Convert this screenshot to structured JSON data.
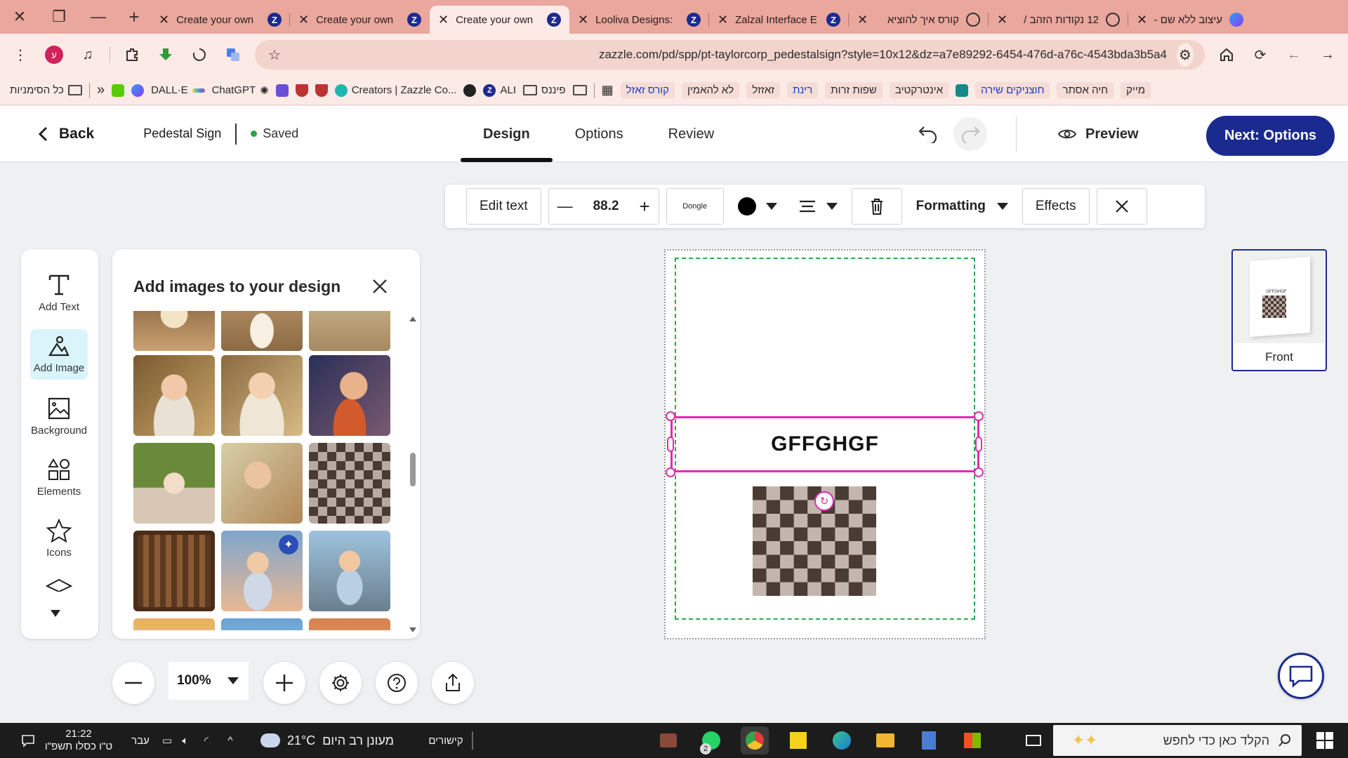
{
  "browser": {
    "tabs": [
      {
        "title": "Create your own",
        "favicon": "zazzle-icon"
      },
      {
        "title": "Create your own",
        "favicon": "zazzle-icon"
      },
      {
        "title": "Create your own",
        "favicon": "zazzle-icon",
        "active": true
      },
      {
        "title": "Looliva Designs:",
        "favicon": "zazzle-icon"
      },
      {
        "title": "Zalzal Interface E",
        "favicon": "zazzle-icon"
      },
      {
        "title": "קורס איך להוציא",
        "favicon": "loading-icon"
      },
      {
        "title": "12 נקודות הזהב /",
        "favicon": "loading-icon"
      },
      {
        "title": "עיצוב ללא שם -",
        "favicon": "canva-icon"
      }
    ],
    "url": "zazzle.com/pd/spp/pt-taylorcorp_pedestalsign?style=10x12&dz=a7e89292-6454-476d-a76c-4543bda3b5a4",
    "profile_initial": "ע",
    "bookmarks": [
      {
        "label": "כל הסימניות",
        "icon": "folder-icon"
      },
      {
        "label": "",
        "icon": "duolingo-icon"
      },
      {
        "label": "",
        "icon": "canva-icon"
      },
      {
        "label": "DALL·E",
        "icon": "dalle-icon"
      },
      {
        "label": "ChatGPT",
        "icon": "chatgpt-icon"
      },
      {
        "label": "",
        "icon": "app-icon"
      },
      {
        "label": "",
        "icon": "shield-icon"
      },
      {
        "label": "",
        "icon": "shield-icon"
      },
      {
        "label": "Creators | Zazzle Co...",
        "icon": "creators-icon"
      },
      {
        "label": "",
        "icon": "globe-icon"
      },
      {
        "label": "ALI",
        "icon": "zazzle-icon"
      },
      {
        "label": "פיננס",
        "icon": "folder-icon"
      },
      {
        "label": "",
        "icon": "folder-icon"
      },
      {
        "label": "קורס זאזל",
        "icon": "apps-grid-icon"
      },
      {
        "label": "לא להאמין"
      },
      {
        "label": "זאזזל"
      },
      {
        "label": "רינת"
      },
      {
        "label": "שפות זרות"
      },
      {
        "label": "אינטרקטיב"
      },
      {
        "label": "חוצניקים שירה",
        "icon": "teal-square-icon"
      },
      {
        "label": "חיה אסתר"
      },
      {
        "label": "מייק"
      }
    ]
  },
  "app": {
    "back_label": "Back",
    "product_name": "Pedestal Sign",
    "saved_label": "Saved",
    "nav_tabs": [
      "Design",
      "Options",
      "Review"
    ],
    "active_tab": "Design",
    "preview_label": "Preview",
    "next_label": "Next: Options"
  },
  "text_toolbar": {
    "edit_text": "Edit text",
    "font_size": "88.2",
    "font_name": "Dongle",
    "text_color": "#000000",
    "formatting": "Formatting",
    "effects": "Effects"
  },
  "rail": {
    "items": [
      {
        "label": "Add Text",
        "icon": "text-icon"
      },
      {
        "label": "Add Image",
        "icon": "image-icon",
        "active": true
      },
      {
        "label": "Background",
        "icon": "background-icon"
      },
      {
        "label": "Elements",
        "icon": "elements-icon"
      },
      {
        "label": "Icons",
        "icon": "star-icon"
      }
    ]
  },
  "image_panel": {
    "title": "Add images to your design"
  },
  "zoom": {
    "value": "100%"
  },
  "canvas": {
    "text_content": "GFFGHGF"
  },
  "views": {
    "front_label": "Front"
  },
  "taskbar": {
    "time": "21:22",
    "date": "ט\"ו כסלו תשפ\"ו",
    "language": "עבר",
    "weather_temp": "21°C",
    "weather_text": "מעונן רב היום",
    "links_label": "קישורים",
    "search_placeholder": "הקלד כאן כדי לחפש",
    "badge_count": "2"
  },
  "colors": {
    "accent": "#1a2a8e",
    "selection": "#e22ab0",
    "safe_zone": "#2eaa4a",
    "tab_strip": "#e9a79d"
  }
}
